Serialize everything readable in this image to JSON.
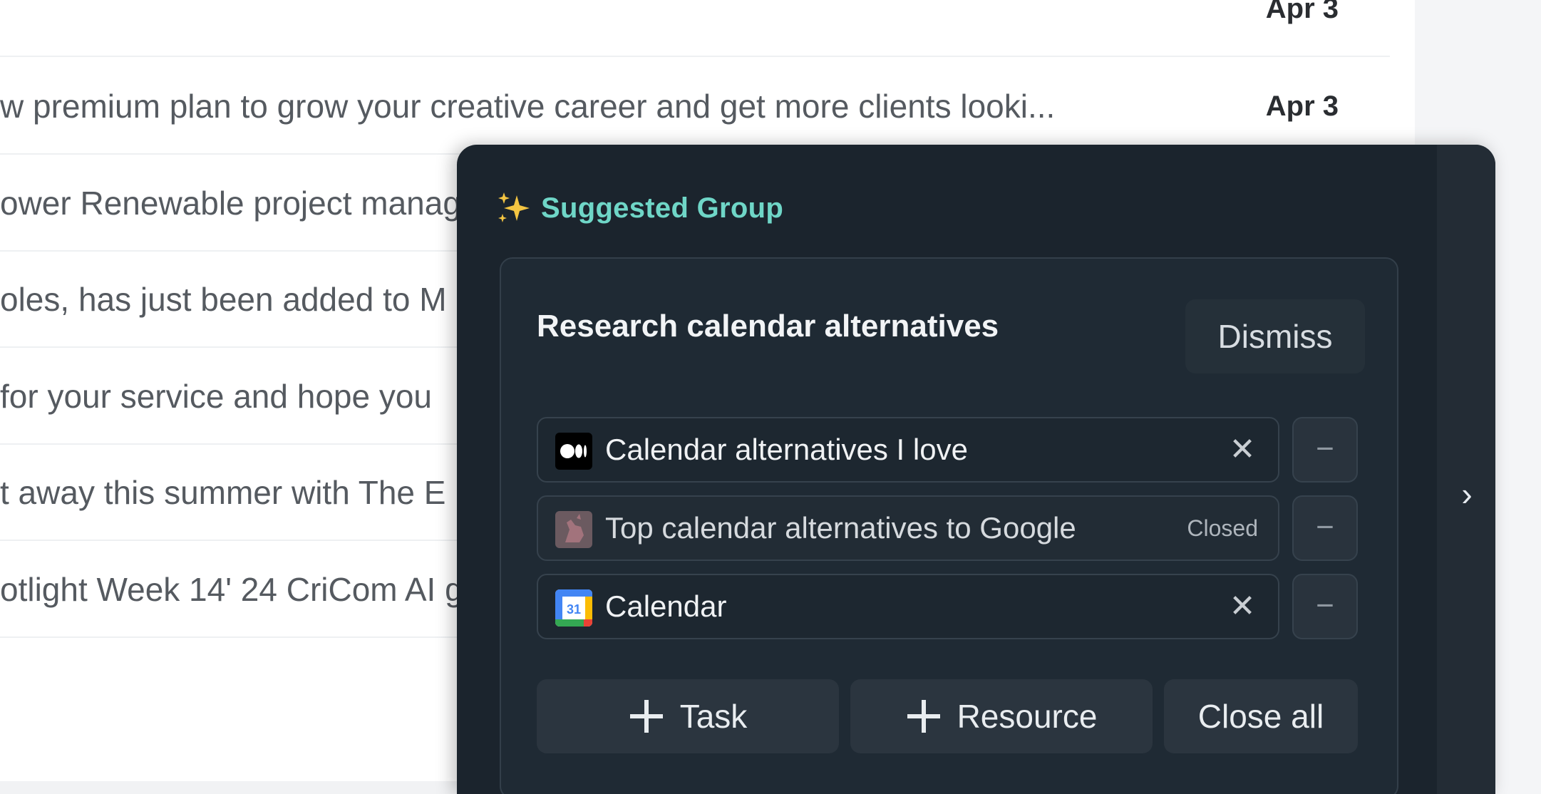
{
  "email_list": {
    "rows": [
      {
        "snippet": "",
        "date": "Apr 3"
      },
      {
        "snippet": "w premium plan to grow your creative career and get more clients looki...",
        "date": "Apr 3"
      },
      {
        "snippet": "ower Renewable project manag",
        "date": ""
      },
      {
        "snippet": "oles, has just been added to M",
        "date": ""
      },
      {
        "snippet": "for your service and hope you",
        "date": ""
      },
      {
        "snippet": "t away this summer with The E",
        "date": ""
      },
      {
        "snippet": "otlight Week 14' 24 CriCom AI g",
        "date": ""
      }
    ]
  },
  "panel": {
    "title": "Suggested Group",
    "title_icon": "sparkles-icon",
    "accent_color": "#6fd6c7",
    "expand_icon": "chevron-right-icon",
    "group": {
      "name": "Research calendar alternatives",
      "dismiss_label": "Dismiss",
      "resources": [
        {
          "label": "Calendar alternatives I love",
          "favicon": "medium-logo-icon",
          "status": "",
          "close_symbol": "✕",
          "remove_symbol": "−"
        },
        {
          "label": "Top calendar alternatives to Google",
          "favicon": "kangaroo-thumbnail-icon",
          "status": "Closed",
          "close_symbol": "",
          "remove_symbol": "−"
        },
        {
          "label": "Calendar",
          "favicon": "google-calendar-icon",
          "status": "",
          "close_symbol": "✕",
          "remove_symbol": "−"
        }
      ],
      "actions": {
        "add_task_label": "Task",
        "add_resource_label": "Resource",
        "close_all_label": "Close all"
      }
    }
  }
}
